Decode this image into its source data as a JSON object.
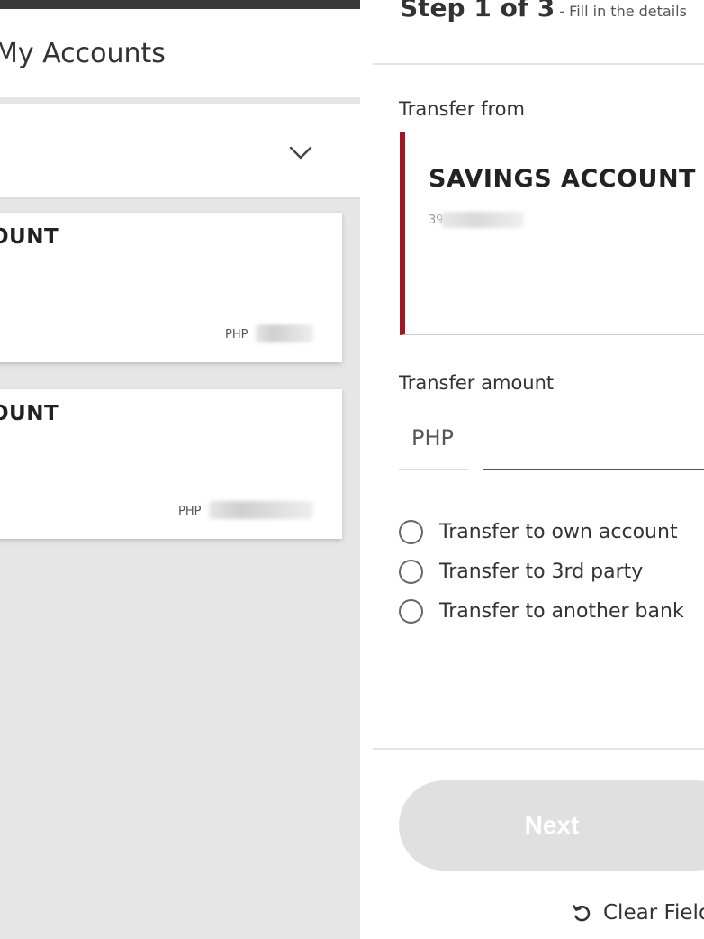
{
  "left_panel": {
    "header_title": "My Accounts",
    "accounts": [
      {
        "name": "OUNT",
        "currency": "PHP"
      },
      {
        "name": "OUNT",
        "currency": "PHP"
      }
    ]
  },
  "right_panel": {
    "step_title": "Step 1 of 3",
    "step_subtitle": "- Fill in the details",
    "transfer_from_label": "Transfer from",
    "from_account": {
      "name": "SAVINGS ACCOUNT",
      "number_prefix": "39"
    },
    "transfer_amount_label": "Transfer amount",
    "amount_currency": "PHP",
    "amount_value": "",
    "transfer_options": [
      "Transfer to own account",
      "Transfer to 3rd party",
      "Transfer to another bank"
    ],
    "next_label": "Next",
    "clear_label": "Clear Fields"
  },
  "colors": {
    "accent": "#a31521",
    "disabled_button": "#e0e0e0",
    "panel_bg": "#e6e6e6"
  },
  "icons": [
    "chevron-down-icon",
    "refresh-icon"
  ]
}
